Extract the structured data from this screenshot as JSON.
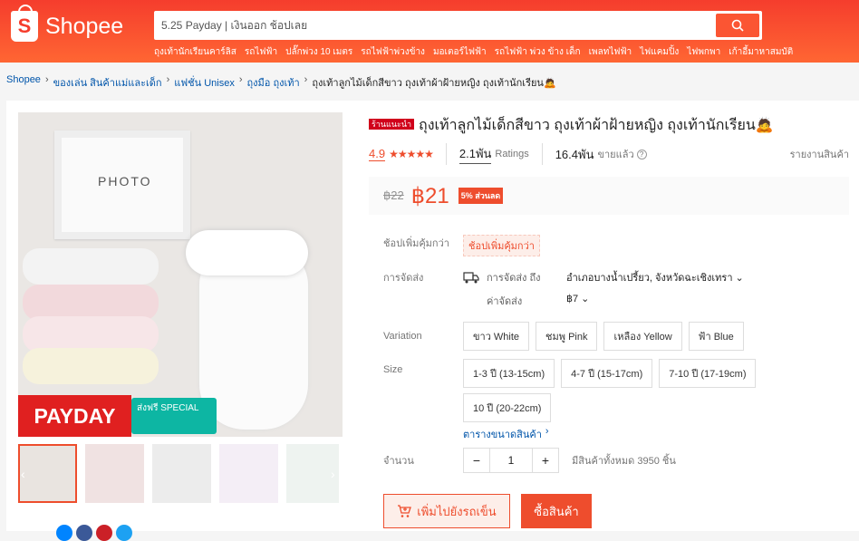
{
  "brand": {
    "name": "Shopee"
  },
  "search": {
    "value": "5.25 Payday | เงินออก ช้อปเลย"
  },
  "hints": [
    "ถุงเท้านักเรียนคาร์ลิส",
    "รถไฟฟ้า",
    "ปลั๊กพ่วง 10 เมตร",
    "รถไฟฟ้าพ่วงข้าง",
    "มอเตอร์ไฟฟ้า",
    "รถไฟฟ้า พ่วง ข้าง เด็ก",
    "เพลทไฟฟ้า",
    "ไฟแคมปิ้ง",
    "ไฟพกพา",
    "เก้าอี้มาหาสมบัติ"
  ],
  "breadcrumb": [
    "Shopee",
    "ของเล่น สินค้าแม่และเด็ก",
    "แฟชั่น Unisex",
    "ถุงมือ ถุงเท้า",
    "ถุงเท้าลูกไม้เด็กสีขาว ถุงเท้าผ้าฝ้ายหญิง ถุงเท้านักเรียน🙇"
  ],
  "gallery": {
    "frame_text": "PHOTO",
    "payday": "PAYDAY",
    "freeship": "ส่งฟรี SPECIAL"
  },
  "product": {
    "badge": "ร้านแนะนำ",
    "title": "ถุงเท้าลูกไม้เด็กสีขาว ถุงเท้าผ้าฝ้ายหญิง ถุงเท้านักเรียน🙇",
    "rating": "4.9",
    "stars": "★★★★★",
    "ratings_count": "2.1พัน",
    "ratings_label": "Ratings",
    "sold_count": "16.4พัน",
    "sold_label": "ขายแล้ว",
    "report": "รายงานสินค้า",
    "old_price": "฿22",
    "price": "฿21",
    "discount": "5% ส่วนลด"
  },
  "details": {
    "voucher_label": "ช้อปเพิ่มคุ้มกว่า",
    "voucher_tag": "ช้อปเพิ่มคุ้มกว่า",
    "shipping_label": "การจัดส่ง",
    "ship_to_label": "การจัดส่ง ถึง",
    "ship_to_value": "อำเภอบางน้ำเปรี้ยว, จังหวัดฉะเชิงเทรา",
    "ship_fee_label": "ค่าจัดส่ง",
    "ship_fee_value": "฿7",
    "variation_label": "Variation",
    "variations": [
      "ขาว White",
      "ชมพู Pink",
      "เหลือง Yellow",
      "ฟ้า Blue"
    ],
    "size_label": "Size",
    "sizes": [
      "1-3 ปี (13-15cm)",
      "4-7 ปี (15-17cm)",
      "7-10 ปี (17-19cm)",
      "10 ปี (20-22cm)"
    ],
    "size_chart": "ตารางขนาดสินค้า",
    "qty_label": "จำนวน",
    "qty_value": "1",
    "stock": "มีสินค้าทั้งหมด 3950 ชิ้น",
    "add_to_cart": "เพิ่มไปยังรถเข็น",
    "buy_now": "ซื้อสินค้า"
  }
}
